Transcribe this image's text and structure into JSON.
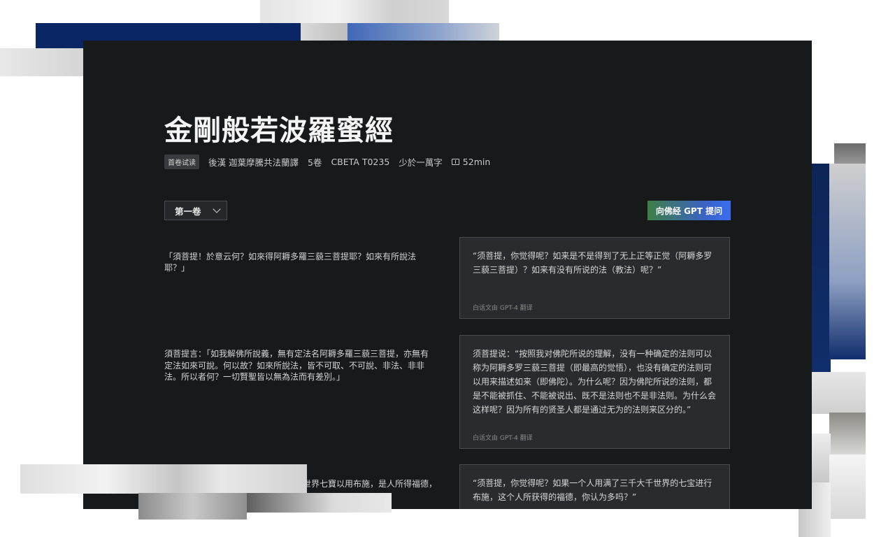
{
  "sutra": {
    "title": "金剛般若波羅蜜經",
    "badge": "首卷试读",
    "translator": "後漢 迦葉摩騰共法蘭譯",
    "volumes": "5卷",
    "catalog_id": "CBETA T0235",
    "length": "少於一萬字",
    "reading_time": "52min"
  },
  "controls": {
    "volume_selected": "第一卷",
    "ask_button": "向佛经 GPT 提问"
  },
  "passages": [
    {
      "original": "「須菩提！於意云何？如來得阿耨多羅三藐三菩提耶？如來有所說法耶？」",
      "translation": "“须菩提，你觉得呢？如来是不是得到了无上正等正觉（阿耨多罗三藐三菩提）？如来有没有所说的法（教法）呢？”",
      "note": "白话文由 GPT-4 翻译"
    },
    {
      "original": "須菩提言：「如我解佛所說義，無有定法名阿耨多羅三藐三菩提，亦無有定法如來可說。何以故？如來所說法，皆不可取、不可說、非法、非非法。所以者何？一切賢聖皆以無為法而有差別。」",
      "translation": "须菩提说：“按照我对佛陀所说的理解，没有一种确定的法则可以称为阿耨多罗三藐三菩提（即最高的觉悟），也没有确定的法则可以用来描述如来（即佛陀）。为什么呢？因为佛陀所说的法则，都是不能被抓住、不能被说出、既不是法则也不是非法则。为什么会这样呢？因为所有的贤圣人都是通过无为的法则来区分的。”",
      "note": "白话文由 GPT-4 翻译"
    },
    {
      "original": "世界七寶以用布施，是人所得福德，",
      "translation": "“须菩提，你觉得呢？如果一个人用满了三千大千世界的七宝进行布施，这个人所获得的福德，你认为多吗？”"
    }
  ]
}
